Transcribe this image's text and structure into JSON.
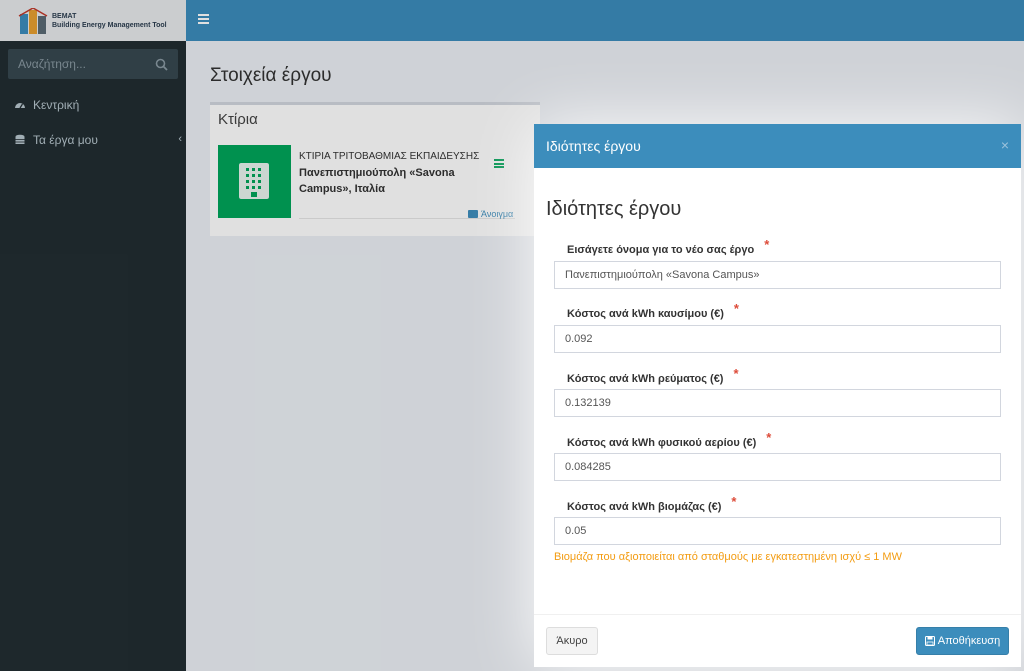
{
  "logo": {
    "line1": "BEMAT",
    "line2": "Building Energy Management Tool"
  },
  "sidebar": {
    "search_placeholder": "Αναζήτηση...",
    "items": [
      {
        "label": "Κεντρική",
        "icon": "dashboard-icon"
      },
      {
        "label": "Τα έργα μου",
        "icon": "database-icon"
      }
    ]
  },
  "main": {
    "page_title": "Στοιχεία έργου",
    "box_title": "Κτίρια",
    "building": {
      "type": "ΚΤΙΡΙΑ ΤΡΙΤΟΒΑΘΜΙΑΣ ΕΚΠΑΙΔΕΥΣΗΣ",
      "name": "Πανεπιστημιούπολη «Savona Campus», Ιταλία",
      "open_label": "Άνοιγμα"
    }
  },
  "modal": {
    "header_title": "Ιδιότητες έργου",
    "heading": "Ιδιότητες έργου",
    "fields": [
      {
        "label": "Εισάγετε όνομα για το νέο σας έργο",
        "value": "Πανεπιστημιούπολη «Savona Campus»"
      },
      {
        "label": "Κόστος ανά kWh καυσίμου (€)",
        "value": "0.092"
      },
      {
        "label": "Κόστος ανά kWh ρεύματος (€)",
        "value": "0.132139"
      },
      {
        "label": "Κόστος ανά kWh φυσικού αερίου (€)",
        "value": "0.084285"
      },
      {
        "label": "Κόστος ανά kWh βιομάζας (€)",
        "value": "0.05"
      }
    ],
    "required_mark": "*",
    "help_text": "Βιομάζα που αξιοποιείται από σταθμούς με εγκατεστημένη ισχύ ≤ 1 MW",
    "cancel_label": "Άκυρο",
    "save_label": "Αποθήκευση"
  },
  "colors": {
    "primary": "#3c8dbc",
    "sidebar": "#222d32",
    "tile": "#00a65a",
    "required": "#dd4b39",
    "help": "#f39c12"
  }
}
